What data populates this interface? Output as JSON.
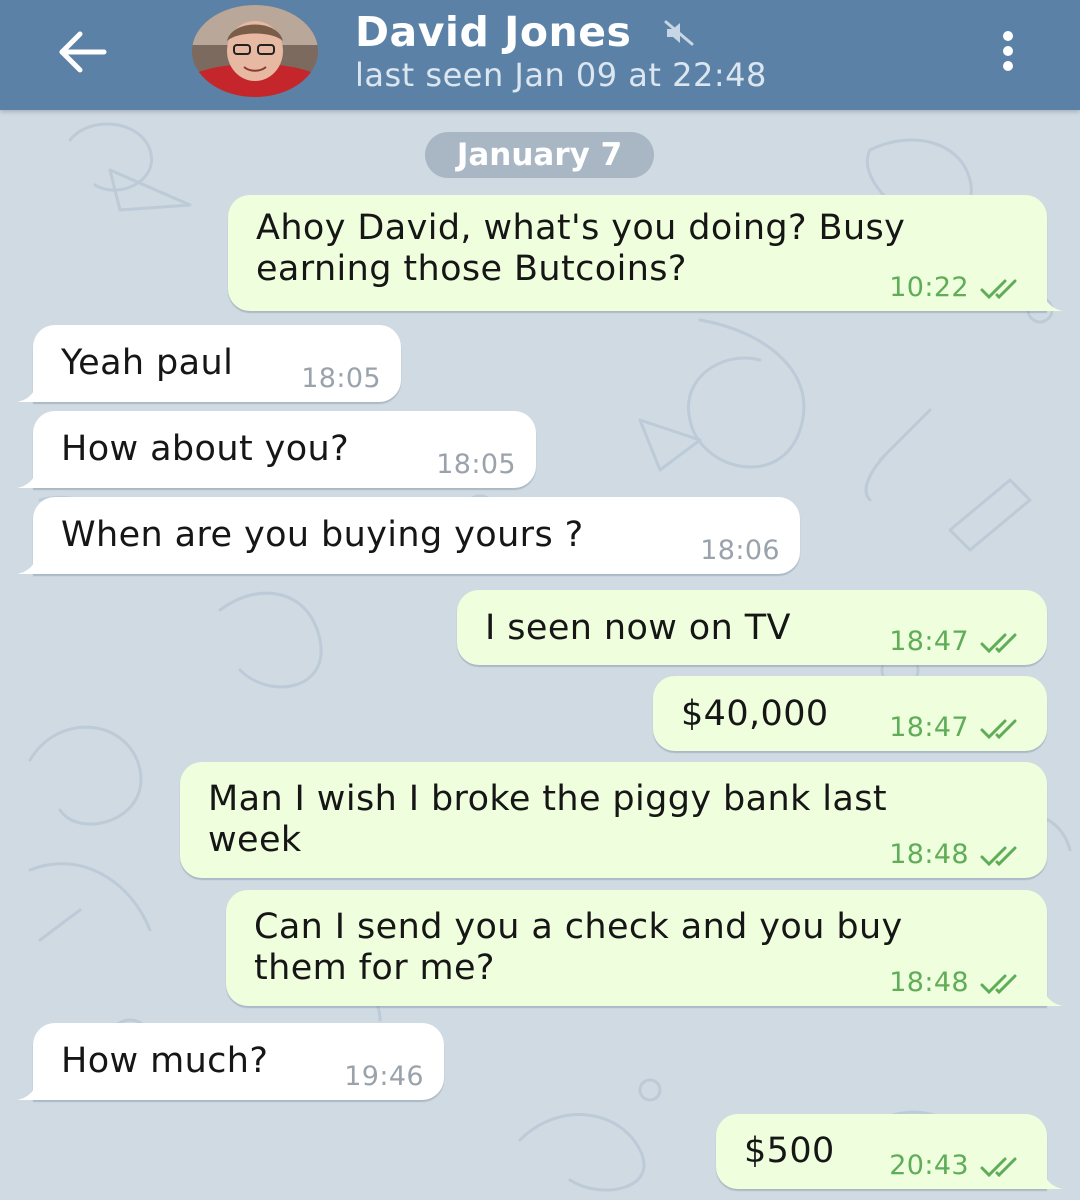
{
  "header": {
    "title": "David Jones",
    "status": "last seen Jan 09 at 22:48",
    "icons": [
      "arrow-left",
      "muted-speaker",
      "more-vertical"
    ]
  },
  "chat": {
    "date_separator": "January 7",
    "messages": [
      {
        "direction": "outgoing",
        "lines": [
          "Ahoy David, what's you doing? Busy",
          "earning those Butcoins?"
        ],
        "time": "10:22",
        "status": "read"
      },
      {
        "direction": "incoming",
        "lines": [
          "Yeah paul"
        ],
        "time": "18:05"
      },
      {
        "direction": "incoming",
        "lines": [
          "How about you?"
        ],
        "time": "18:05"
      },
      {
        "direction": "incoming",
        "lines": [
          "When are you buying yours ?"
        ],
        "time": "18:06"
      },
      {
        "direction": "outgoing",
        "lines": [
          "I seen now on TV"
        ],
        "time": "18:47",
        "status": "read"
      },
      {
        "direction": "outgoing",
        "lines": [
          "$40,000"
        ],
        "time": "18:47",
        "status": "read"
      },
      {
        "direction": "outgoing",
        "lines": [
          "Man I wish I broke the piggy bank last",
          "week"
        ],
        "time": "18:48",
        "status": "read"
      },
      {
        "direction": "outgoing",
        "lines": [
          "Can I send you a check and you buy",
          "them for me?"
        ],
        "time": "18:48",
        "status": "read"
      },
      {
        "direction": "incoming",
        "lines": [
          "How much?"
        ],
        "time": "19:46"
      },
      {
        "direction": "outgoing",
        "lines": [
          "$500"
        ],
        "time": "20:43",
        "status": "read"
      }
    ]
  },
  "colors": {
    "header": "#5b82a6",
    "background": "#cfdae3",
    "incoming_bubble": "#ffffff",
    "outgoing_bubble": "#effedd",
    "outgoing_meta": "#5fad58",
    "incoming_meta": "#9aa3ab"
  }
}
